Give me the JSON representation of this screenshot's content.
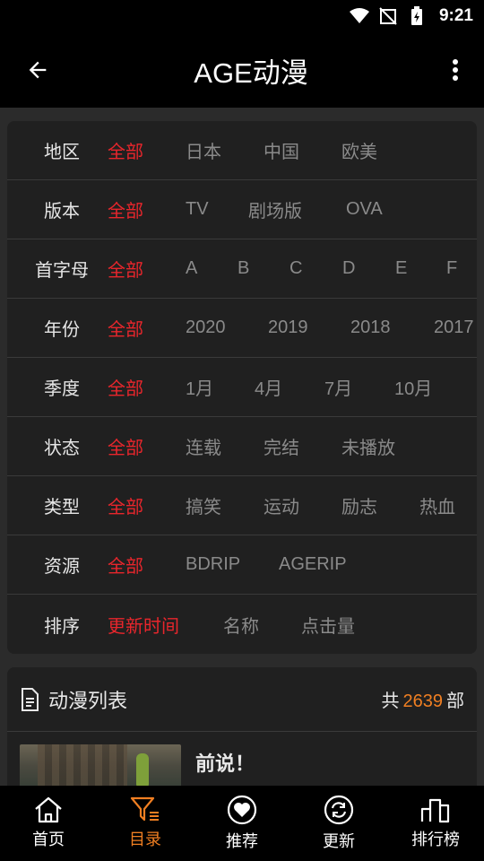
{
  "status_bar": {
    "time": "9:21"
  },
  "app_bar": {
    "title": "AGE动漫"
  },
  "filters": [
    {
      "label": "地区",
      "options": [
        "全部",
        "日本",
        "中国",
        "欧美"
      ],
      "active": 0
    },
    {
      "label": "版本",
      "options": [
        "全部",
        "TV",
        "剧场版",
        "OVA"
      ],
      "active": 0
    },
    {
      "label": "首字母",
      "options": [
        "全部",
        "A",
        "B",
        "C",
        "D",
        "E",
        "F"
      ],
      "active": 0
    },
    {
      "label": "年份",
      "options": [
        "全部",
        "2020",
        "2019",
        "2018",
        "2017"
      ],
      "active": 0
    },
    {
      "label": "季度",
      "options": [
        "全部",
        "1月",
        "4月",
        "7月",
        "10月"
      ],
      "active": 0
    },
    {
      "label": "状态",
      "options": [
        "全部",
        "连载",
        "完结",
        "未播放"
      ],
      "active": 0
    },
    {
      "label": "类型",
      "options": [
        "全部",
        "搞笑",
        "运动",
        "励志",
        "热血"
      ],
      "active": 0
    },
    {
      "label": "资源",
      "options": [
        "全部",
        "BDRIP",
        "AGERIP"
      ],
      "active": 0
    },
    {
      "label": "排序",
      "options": [
        "更新时间",
        "名称",
        "点击量"
      ],
      "active": 0
    }
  ],
  "list": {
    "title": "动漫列表",
    "count_prefix": "共",
    "count": "2639",
    "count_suffix": "部",
    "items": [
      {
        "title": "前说！"
      }
    ]
  },
  "bottom_nav": [
    {
      "label": "首页",
      "icon": "home-icon"
    },
    {
      "label": "目录",
      "icon": "filter-icon",
      "active": true
    },
    {
      "label": "推荐",
      "icon": "heart-icon"
    },
    {
      "label": "更新",
      "icon": "refresh-icon"
    },
    {
      "label": "排行榜",
      "icon": "ranking-icon"
    }
  ],
  "colors": {
    "accent_red": "#e8262c",
    "accent_orange": "#f07f22"
  }
}
